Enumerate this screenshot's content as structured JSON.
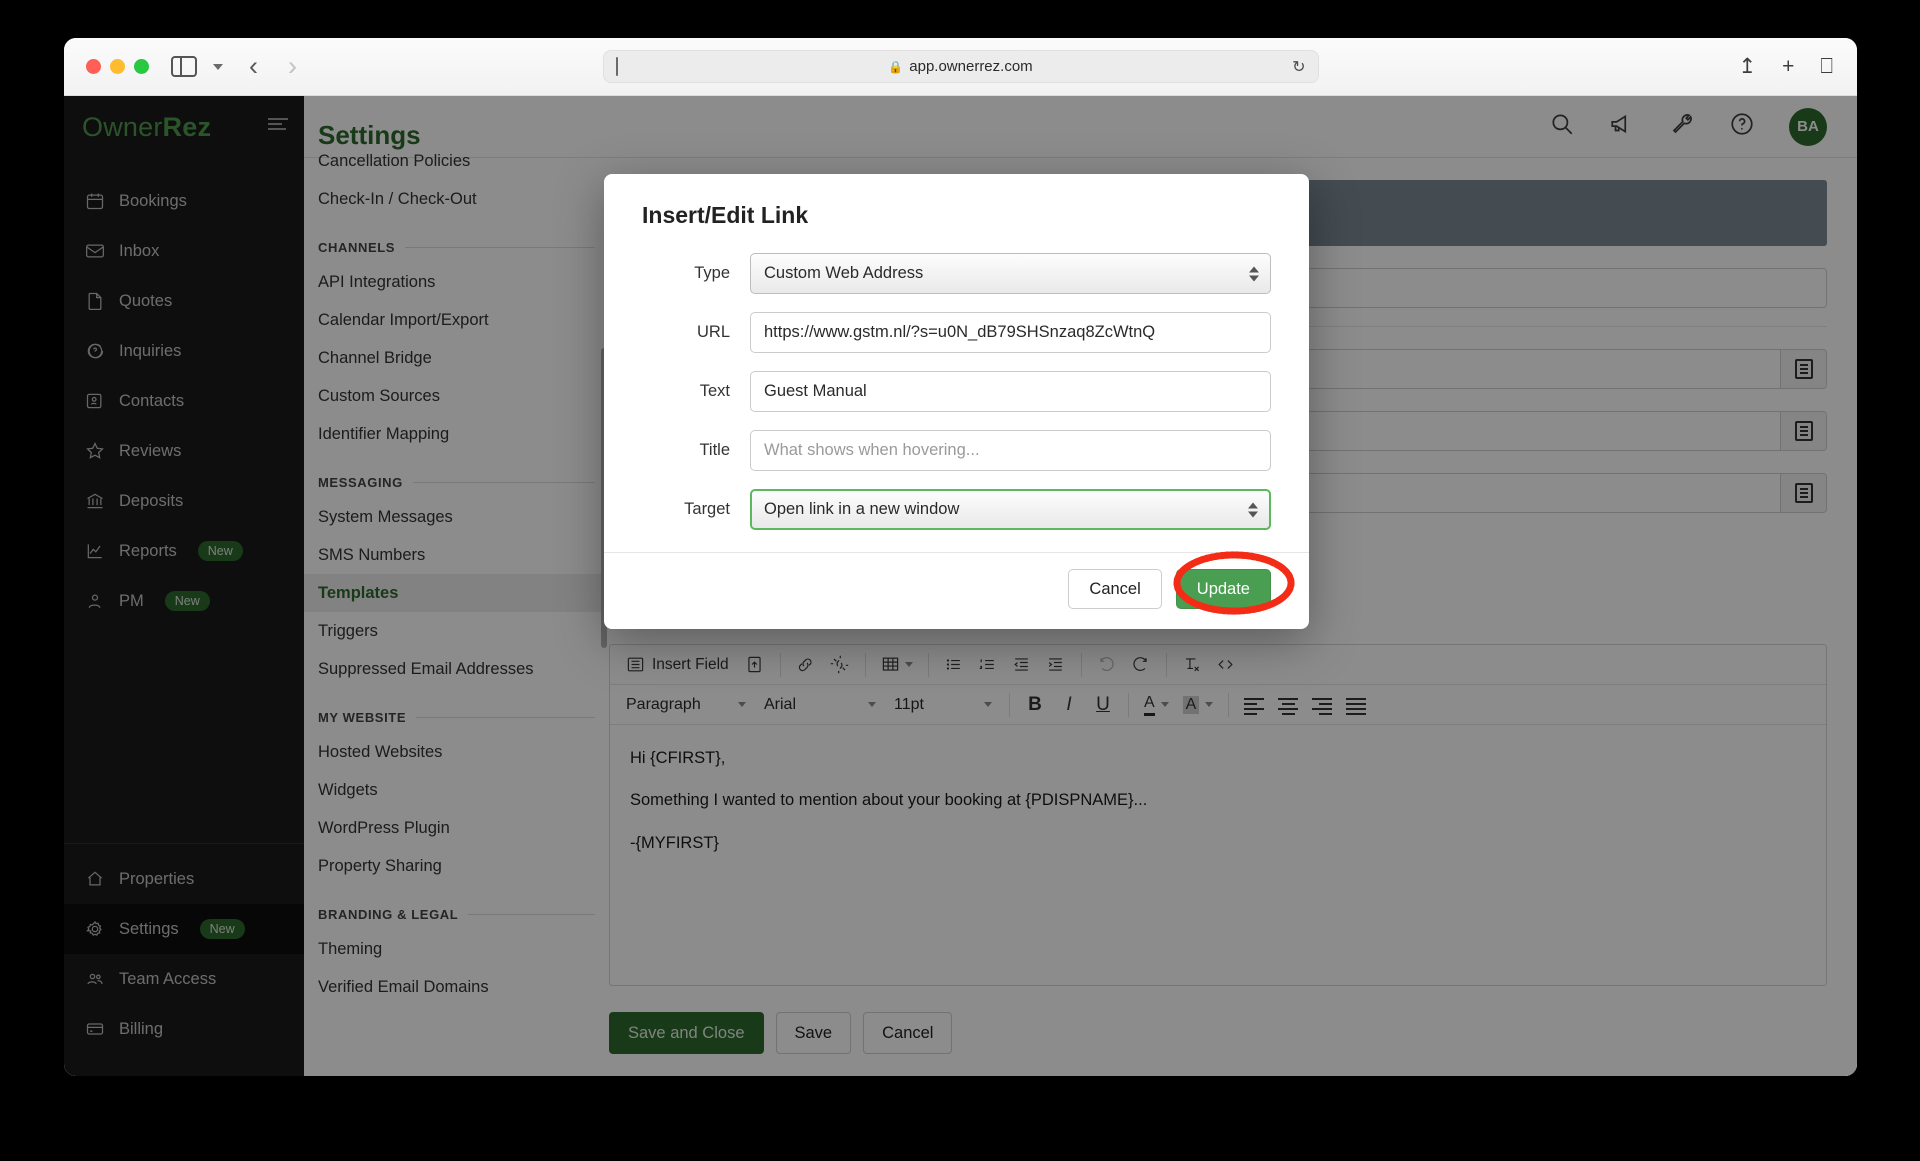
{
  "browser": {
    "url": "app.ownerrez.com",
    "lock_icon": "lock-icon",
    "reload_icon": "reload-icon",
    "back_icon": "back-arrow-icon",
    "forward_icon": "forward-arrow-icon",
    "sidebar_icon": "sidebar-toggle-icon",
    "share_icon": "share-icon",
    "new_tab_icon": "new-tab-icon",
    "tabs_icon": "tab-overview-icon"
  },
  "brand": {
    "first": "Owner",
    "second": "Rez"
  },
  "sidebar": {
    "items": [
      {
        "label": "Bookings",
        "icon": "calendar-icon",
        "badge": ""
      },
      {
        "label": "Inbox",
        "icon": "envelope-icon",
        "badge": ""
      },
      {
        "label": "Quotes",
        "icon": "document-icon",
        "badge": ""
      },
      {
        "label": "Inquiries",
        "icon": "question-bubble-icon",
        "badge": ""
      },
      {
        "label": "Contacts",
        "icon": "contact-card-icon",
        "badge": ""
      },
      {
        "label": "Reviews",
        "icon": "star-icon",
        "badge": ""
      },
      {
        "label": "Deposits",
        "icon": "bank-icon",
        "badge": ""
      },
      {
        "label": "Reports",
        "icon": "chart-line-icon",
        "badge": "New"
      },
      {
        "label": "PM",
        "icon": "person-gear-icon",
        "badge": "New"
      }
    ],
    "bottom_items": [
      {
        "label": "Properties",
        "icon": "home-icon",
        "badge": "",
        "active": false
      },
      {
        "label": "Settings",
        "icon": "gear-icon",
        "badge": "New",
        "active": true
      },
      {
        "label": "Team Access",
        "icon": "people-icon",
        "badge": "",
        "active": false
      },
      {
        "label": "Billing",
        "icon": "credit-card-icon",
        "badge": "",
        "active": false
      }
    ]
  },
  "settings": {
    "title": "Settings",
    "entries": [
      {
        "type": "item",
        "label": "Cancellation Policies",
        "active": false,
        "clipped": true
      },
      {
        "type": "item",
        "label": "Check-In / Check-Out",
        "active": false
      },
      {
        "type": "group",
        "label": "CHANNELS"
      },
      {
        "type": "item",
        "label": "API Integrations",
        "active": false
      },
      {
        "type": "item",
        "label": "Calendar Import/Export",
        "active": false
      },
      {
        "type": "item",
        "label": "Channel Bridge",
        "active": false
      },
      {
        "type": "item",
        "label": "Custom Sources",
        "active": false
      },
      {
        "type": "item",
        "label": "Identifier Mapping",
        "active": false
      },
      {
        "type": "group",
        "label": "MESSAGING"
      },
      {
        "type": "item",
        "label": "System Messages",
        "active": false
      },
      {
        "type": "item",
        "label": "SMS Numbers",
        "active": false
      },
      {
        "type": "item",
        "label": "Templates",
        "active": true
      },
      {
        "type": "item",
        "label": "Triggers",
        "active": false
      },
      {
        "type": "item",
        "label": "Suppressed Email Addresses",
        "active": false
      },
      {
        "type": "group",
        "label": "MY WEBSITE"
      },
      {
        "type": "item",
        "label": "Hosted Websites",
        "active": false
      },
      {
        "type": "item",
        "label": "Widgets",
        "active": false
      },
      {
        "type": "item",
        "label": "WordPress Plugin",
        "active": false
      },
      {
        "type": "item",
        "label": "Property Sharing",
        "active": false
      },
      {
        "type": "group",
        "label": "BRANDING & LEGAL"
      },
      {
        "type": "item",
        "label": "Theming",
        "active": false
      },
      {
        "type": "item",
        "label": "Verified Email Domains",
        "active": false
      }
    ]
  },
  "header": {
    "icons": [
      {
        "name": "search-icon"
      },
      {
        "name": "megaphone-icon"
      },
      {
        "name": "wrench-icon"
      },
      {
        "name": "help-circle-icon"
      }
    ],
    "avatar_initials": "BA"
  },
  "background_form": {
    "fields": [
      {
        "value": "",
        "has_insert_button": false
      },
      {
        "value": "}",
        "has_insert_button": true
      },
      {
        "value": "",
        "has_insert_button": true
      },
      {
        "value": "",
        "has_insert_button": true
      }
    ]
  },
  "editor": {
    "toolbar_row1": [
      {
        "name": "insert-field-button",
        "label": "Insert Field",
        "icon": "list-box-icon"
      },
      {
        "name": "insert-image-button",
        "label": "",
        "icon": "image-upload-icon"
      },
      {
        "name": "insert-link-button",
        "label": "",
        "icon": "link-icon"
      },
      {
        "name": "unlink-button",
        "label": "",
        "icon": "unlink-icon"
      },
      {
        "name": "table-button",
        "label": "",
        "icon": "table-icon"
      },
      {
        "name": "bullet-list-button",
        "label": "",
        "icon": "bullet-list-icon"
      },
      {
        "name": "numbered-list-button",
        "label": "",
        "icon": "numbered-list-icon"
      },
      {
        "name": "outdent-button",
        "label": "",
        "icon": "outdent-icon"
      },
      {
        "name": "indent-button",
        "label": "",
        "icon": "indent-icon"
      },
      {
        "name": "undo-button",
        "label": "",
        "icon": "undo-icon"
      },
      {
        "name": "redo-button",
        "label": "",
        "icon": "redo-icon"
      },
      {
        "name": "clear-formatting-button",
        "label": "",
        "icon": "clear-format-icon"
      },
      {
        "name": "source-code-button",
        "label": "",
        "icon": "code-icon"
      }
    ],
    "format_block": "Paragraph",
    "font_family": "Arial",
    "font_size": "11pt",
    "bold": "B",
    "italic": "I",
    "underline": "U",
    "text_color": "A",
    "highlight_color": "A",
    "body": [
      "Hi {CFIRST},",
      "Something I wanted to mention about your booking at {PDISPNAME}...",
      "-{MYFIRST}"
    ]
  },
  "bottom_buttons": {
    "save_and_close": "Save and Close",
    "save": "Save",
    "cancel": "Cancel"
  },
  "modal": {
    "title": "Insert/Edit Link",
    "fields": {
      "type_label": "Type",
      "type_value": "Custom Web Address",
      "url_label": "URL",
      "url_value": "https://www.gstm.nl/?s=u0N_dB79SHSnzaq8ZcWtnQ",
      "text_label": "Text",
      "text_value": "Guest Manual",
      "title_label": "Title",
      "title_value": "",
      "title_placeholder": "What shows when hovering...",
      "target_label": "Target",
      "target_value": "Open link in a new window"
    },
    "cancel_button": "Cancel",
    "update_button": "Update",
    "annotation_color": "#f32c16"
  }
}
